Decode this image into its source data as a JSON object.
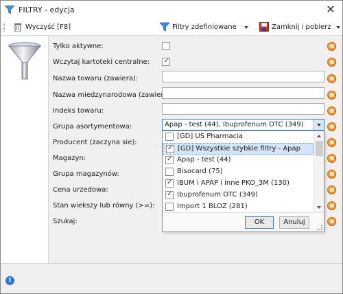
{
  "window": {
    "title": "FILTRY - edycja",
    "close_glyph": "✕"
  },
  "toolbar": {
    "clear_label": "Wyczyść [F8]",
    "defined_filters_label": "Filtry zdefiniowane",
    "close_get_label": "Zamknij i pobierz"
  },
  "form": {
    "fields": [
      {
        "label": "Tylko aktywne:",
        "type": "checkbox",
        "checked": false
      },
      {
        "label": "Wczytaj kartoteki centralne:",
        "type": "checkbox",
        "checked": true
      },
      {
        "label": "Nazwa towaru (zawiera):",
        "type": "text",
        "value": ""
      },
      {
        "label": "Nazwa miedzynarodowa (zawiera):",
        "type": "text",
        "value": ""
      },
      {
        "label": "Indeks towaru:",
        "type": "text",
        "value": ""
      },
      {
        "label": "Grupa asortymentowa:",
        "type": "combo",
        "value": "Apap -  test (44), Ibuprofenum OTC (349)"
      },
      {
        "label": "Producent (zaczyna sie):"
      },
      {
        "label": "Magazyn:"
      },
      {
        "label": "Grupa magazynów:"
      },
      {
        "label": "Cena urzedowa:"
      },
      {
        "label": "Stan wiekszy lub równy (>=):"
      },
      {
        "label": "Szukaj:"
      }
    ]
  },
  "dropdown": {
    "items": [
      {
        "label": "[GD] US Pharmacia",
        "checked": false,
        "selected": false
      },
      {
        "label": "[GD] Wszystkie szybkie filtry - Apap",
        "checked": true,
        "selected": true
      },
      {
        "label": "Apap -  test (44)",
        "checked": true,
        "selected": false
      },
      {
        "label": "Bisocard (75)",
        "checked": false,
        "selected": false
      },
      {
        "label": "IBUM i APAP i inne PKO_3M (130)",
        "checked": true,
        "selected": false
      },
      {
        "label": "Ibuprofenum OTC (349)",
        "checked": true,
        "selected": false
      },
      {
        "label": "Import 1 BLOZ (281)",
        "checked": false,
        "selected": false
      }
    ],
    "ok_label": "OK",
    "cancel_label": "Anuluj"
  },
  "status": {
    "info_glyph": "i"
  },
  "colors": {
    "clear_icon": "#f07800",
    "accent": "#3b7dd8",
    "info": "#2a78d2"
  },
  "icons": {
    "filter_panel": "funnel-icon",
    "clear_field": "clear-field-icon",
    "status": "info-icon"
  }
}
